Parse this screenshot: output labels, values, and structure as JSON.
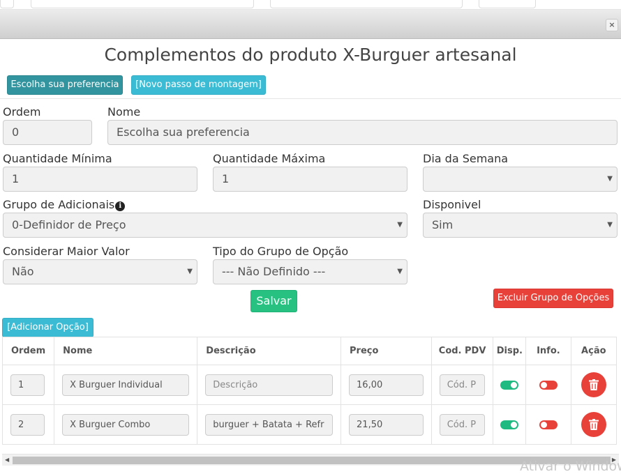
{
  "modal": {
    "close_label": "×",
    "title": "Complementos do produto X-Burguer artesanal"
  },
  "toolbar": {
    "preference_button": "Escolha sua preferencia",
    "new_step_button": "[Novo passo de montagem]"
  },
  "form": {
    "ordem_label": "Ordem",
    "ordem_value": "0",
    "nome_label": "Nome",
    "nome_value": "Escolha sua preferencia",
    "qtd_min_label": "Quantidade Mínima",
    "qtd_min_value": "1",
    "qtd_max_label": "Quantidade Máxima",
    "qtd_max_value": "1",
    "dia_label": "Dia da Semana",
    "dia_value": "",
    "grupo_label": "Grupo de Adicionais",
    "grupo_value": "0-Definidor de Preço",
    "disponivel_label": "Disponivel",
    "disponivel_value": "Sim",
    "maior_valor_label": "Considerar Maior Valor",
    "maior_valor_value": "Não",
    "tipo_label": "Tipo do Grupo de Opção",
    "tipo_value": "--- Não Definido ---",
    "save_button": "Salvar",
    "delete_group_button": "Excluir Grupo de Opções",
    "add_option_button": "[Adicionar Opção]"
  },
  "table": {
    "headers": [
      "Ordem",
      "Nome",
      "Descrição",
      "Preço",
      "Cod. PDV",
      "Disp.",
      "Info.",
      "Ação"
    ],
    "description_placeholder": "Descrição",
    "pdv_placeholder": "Cód. P",
    "rows": [
      {
        "ordem": "1",
        "nome": "X Burguer Individual",
        "descricao": "",
        "preco": "16,00",
        "pdv": "",
        "disp": true,
        "info": false
      },
      {
        "ordem": "2",
        "nome": "X Burguer Combo",
        "descricao": "burguer  + Batata + Refr",
        "preco": "21,50",
        "pdv": "",
        "disp": true,
        "info": false
      }
    ]
  },
  "colors": {
    "teal": "#31949e",
    "cyan": "#3bbcd4",
    "green": "#27c282",
    "red": "#e8413a"
  },
  "icons": {
    "close": "close-icon",
    "info": "info-icon",
    "trash": "trash-icon",
    "caret": "caret-down-icon"
  },
  "watermark": "Ativar o Windows"
}
